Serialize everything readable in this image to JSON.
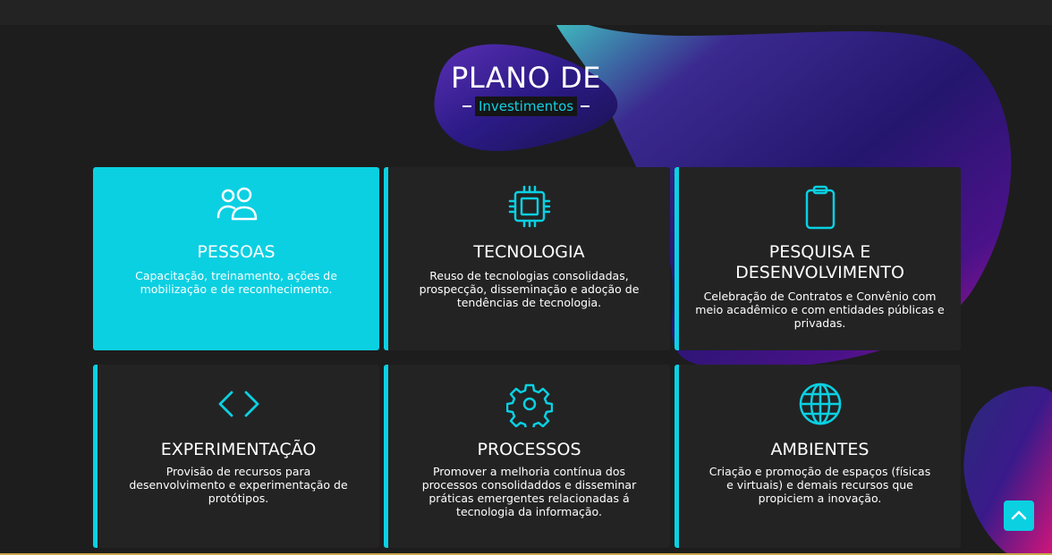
{
  "heading": {
    "title": "PLANO DE",
    "subtitle": "Investimentos"
  },
  "colors": {
    "accent": "#0bd0e2",
    "background": "#1d1d1d",
    "card": "#232323"
  },
  "cards": [
    {
      "icon": "users-icon",
      "title": "PESSOAS",
      "text": "Capacitação, treinamento, ações de mobilização e de reconhecimento."
    },
    {
      "icon": "cpu-chip-icon",
      "title": "TECNOLOGIA",
      "text": "Reuso de tecnologias consolidadas, prospecção, disseminação e adoção de tendências de tecnologia."
    },
    {
      "icon": "clipboard-icon",
      "title": "PESQUISA E DESENVOLVIMENTO",
      "text": "Celebração de Contratos e Convênio com meio acadêmico e com entidades públicas e privadas."
    },
    {
      "icon": "code-brackets-icon",
      "title": "EXPERIMENTAÇÃO",
      "text": "Provisão de recursos para desenvolvimento e experimentação de protótipos."
    },
    {
      "icon": "gear-icon",
      "title": "PROCESSOS",
      "text": "Promover a melhoria contínua dos processos consolidaddos e disseminar práticas emergentes relacionadas á tecnologia da informação."
    },
    {
      "icon": "globe-icon",
      "title": "AMBIENTES",
      "text": "Criação e promoção de espaços (físicas e virtuais) e demais recursos que propiciem a inovação."
    }
  ],
  "scroll_top": {
    "icon": "chevron-up-icon"
  }
}
